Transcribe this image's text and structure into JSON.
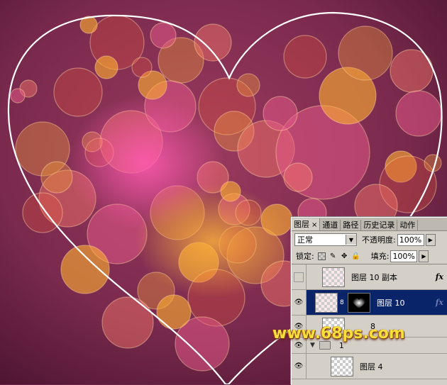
{
  "artwork": {
    "background_color": "#6e2446",
    "heart_stroke_color": "#ffffff",
    "bokeh_colors": [
      "#f25a3a",
      "#f7a23a",
      "#ff7a6a",
      "#e85a8a",
      "#ffb030"
    ]
  },
  "watermark": {
    "text": "www.68ps.com",
    "color": "#f7e03c"
  },
  "layers_panel": {
    "tabs": [
      {
        "label": "图层",
        "active": true,
        "close": "×"
      },
      {
        "label": "通道"
      },
      {
        "label": "路径"
      },
      {
        "label": "历史记录"
      },
      {
        "label": "动作"
      }
    ],
    "blend_mode": "正常",
    "opacity_label": "不透明度:",
    "opacity_value": "100%",
    "lock_label": "锁定:",
    "fill_label": "填充:",
    "fill_value": "100%",
    "layers": [
      {
        "name": "图层 10 副本",
        "visible": false,
        "fx": "fx"
      },
      {
        "name": "图层 10",
        "visible": true,
        "selected": true,
        "fx": "fx",
        "has_mask": true
      },
      {
        "name": "8",
        "visible": true
      },
      {
        "name": "1",
        "visible": true,
        "type": "group"
      },
      {
        "name": "图层 4",
        "visible": true
      }
    ],
    "selection_color": "#0a246a"
  }
}
